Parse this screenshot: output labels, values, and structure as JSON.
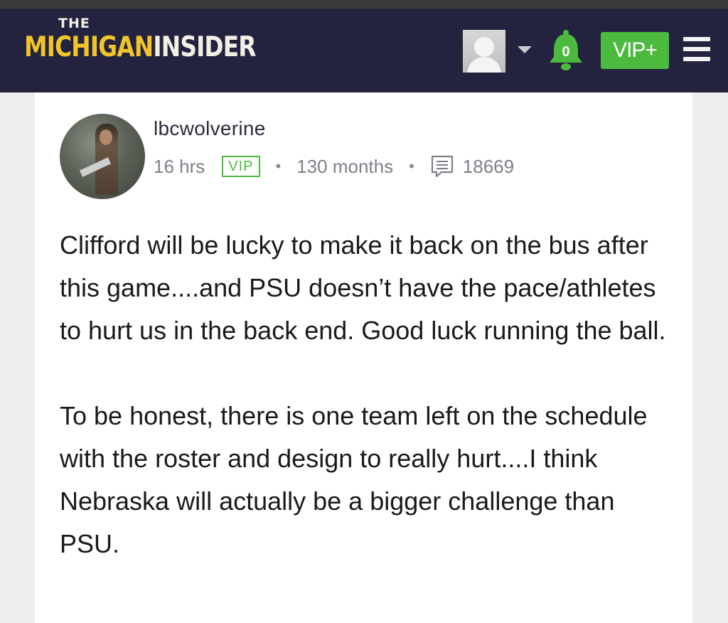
{
  "header": {
    "logo_the": "THE",
    "logo_michigan": "MICHIGAN",
    "logo_insider": "INSIDER",
    "notification_count": "0",
    "vip_label": "VIP+",
    "colors": {
      "background": "#24233f",
      "accent_gold": "#f0c42a",
      "vip_green": "#4cb93f"
    }
  },
  "post": {
    "username": "lbcwolverine",
    "time": "16 hrs",
    "badge": "VIP",
    "tenure": "130 months",
    "post_count": "18669",
    "paragraphs": [
      "Clifford will be lucky to make it back on the bus after this game....and PSU doesn’t have the pace/athletes to hurt us in the back end. Good luck running the ball.",
      "To be honest, there is one team left on the schedule with the roster and design to really hurt....I think Nebraska will actually be a bigger challenge than PSU."
    ]
  },
  "icons": [
    "user-avatar-icon",
    "chevron-down-icon",
    "bell-icon",
    "hamburger-menu-icon",
    "message-count-icon"
  ]
}
